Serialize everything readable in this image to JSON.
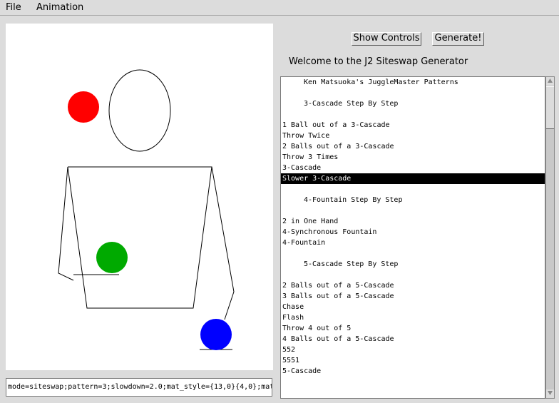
{
  "menu": {
    "file": "File",
    "animation": "Animation"
  },
  "buttons": {
    "show_controls": "Show Controls",
    "generate": "Generate!"
  },
  "welcome_text": "Welcome to the J2 Siteswap Generator",
  "config_field_value": "mode=siteswap;pattern=3;slowdown=2.0;mat_style={13,0}{4,0};mat",
  "patterns": [
    {
      "label": "Ken Matsuoka's JuggleMaster Patterns",
      "kind": "header"
    },
    {
      "label": "",
      "kind": "blank"
    },
    {
      "label": "3-Cascade Step By Step",
      "kind": "header"
    },
    {
      "label": "",
      "kind": "blank"
    },
    {
      "label": "1 Ball out of a 3-Cascade",
      "kind": "item"
    },
    {
      "label": "Throw Twice",
      "kind": "item"
    },
    {
      "label": "2 Balls out of a 3-Cascade",
      "kind": "item"
    },
    {
      "label": "Throw 3 Times",
      "kind": "item"
    },
    {
      "label": "3-Cascade",
      "kind": "item"
    },
    {
      "label": "Slower 3-Cascade",
      "kind": "item",
      "selected": true
    },
    {
      "label": "",
      "kind": "blank"
    },
    {
      "label": "4-Fountain Step By Step",
      "kind": "header"
    },
    {
      "label": "",
      "kind": "blank"
    },
    {
      "label": "2 in One Hand",
      "kind": "item"
    },
    {
      "label": "4-Synchronous Fountain",
      "kind": "item"
    },
    {
      "label": "4-Fountain",
      "kind": "item"
    },
    {
      "label": "",
      "kind": "blank"
    },
    {
      "label": "5-Cascade Step By Step",
      "kind": "header"
    },
    {
      "label": "",
      "kind": "blank"
    },
    {
      "label": "2 Balls out of a 5-Cascade",
      "kind": "item"
    },
    {
      "label": "3 Balls out of a 5-Cascade",
      "kind": "item"
    },
    {
      "label": "Chase",
      "kind": "item"
    },
    {
      "label": "Flash",
      "kind": "item"
    },
    {
      "label": "Throw 4 out of 5",
      "kind": "item"
    },
    {
      "label": "4 Balls out of a 5-Cascade",
      "kind": "item"
    },
    {
      "label": "552",
      "kind": "item"
    },
    {
      "label": "5551",
      "kind": "item"
    },
    {
      "label": "5-Cascade",
      "kind": "item"
    }
  ],
  "animation": {
    "balls": [
      {
        "name": "red-ball",
        "color": "#ff0000"
      },
      {
        "name": "green-ball",
        "color": "#00aa00"
      },
      {
        "name": "blue-ball",
        "color": "#0000ff"
      }
    ]
  },
  "colors": {
    "background": "#dcdcdc",
    "selection": "#000000"
  }
}
